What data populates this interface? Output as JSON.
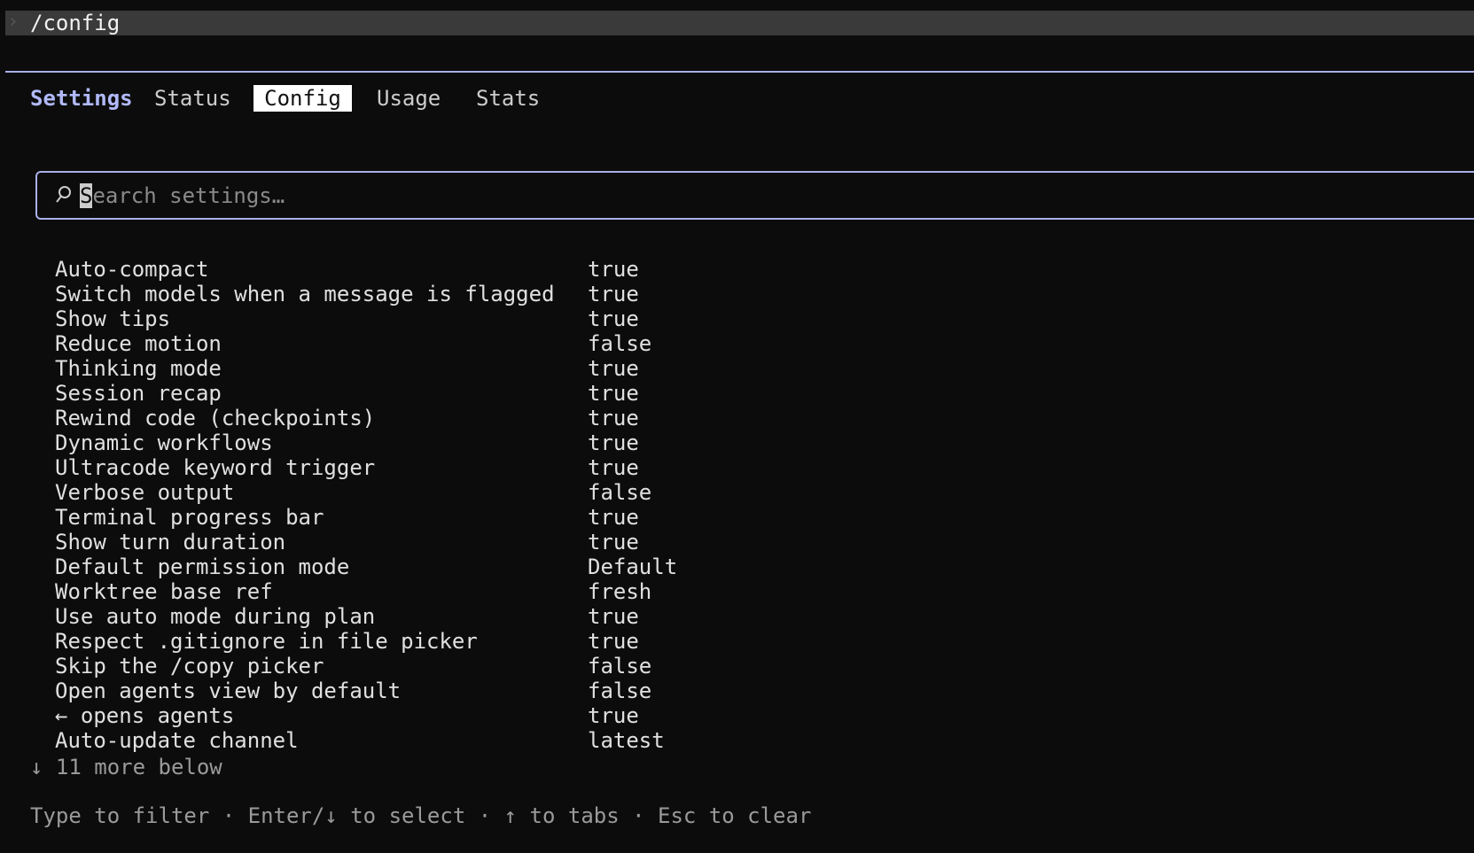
{
  "command": {
    "prompt_icon": "chevron-right-icon",
    "text": "/config"
  },
  "tabs": {
    "title": "Settings",
    "items": [
      "Status",
      "Config",
      "Usage",
      "Stats"
    ],
    "active": "Config"
  },
  "search": {
    "icon": "search-icon",
    "placeholder_cursor_char": "S",
    "placeholder_rest": "earch settings…"
  },
  "settings": [
    {
      "label": "Auto-compact",
      "value": "true"
    },
    {
      "label": "Switch models when a message is flagged",
      "value": "true"
    },
    {
      "label": "Show tips",
      "value": "true"
    },
    {
      "label": "Reduce motion",
      "value": "false"
    },
    {
      "label": "Thinking mode",
      "value": "true"
    },
    {
      "label": "Session recap",
      "value": "true"
    },
    {
      "label": "Rewind code (checkpoints)",
      "value": "true"
    },
    {
      "label": "Dynamic workflows",
      "value": "true"
    },
    {
      "label": "Ultracode keyword trigger",
      "value": "true"
    },
    {
      "label": "Verbose output",
      "value": "false"
    },
    {
      "label": "Terminal progress bar",
      "value": "true"
    },
    {
      "label": "Show turn duration",
      "value": "true"
    },
    {
      "label": "Default permission mode",
      "value": "Default"
    },
    {
      "label": "Worktree base ref",
      "value": "fresh"
    },
    {
      "label": "Use auto mode during plan",
      "value": "true"
    },
    {
      "label": "Respect .gitignore in file picker",
      "value": "true"
    },
    {
      "label": "Skip the /copy picker",
      "value": "false"
    },
    {
      "label": "Open agents view by default",
      "value": "false"
    },
    {
      "label": "← opens agents",
      "value": "true"
    },
    {
      "label": "Auto-update channel",
      "value": "latest"
    }
  ],
  "more_below": "↓ 11 more below",
  "hint": "Type to filter · Enter/↓ to select · ↑ to tabs · Esc to clear",
  "colors": {
    "accent": "#b1b9f9",
    "border": "#a9b0e8",
    "background": "#0c0c0c"
  }
}
